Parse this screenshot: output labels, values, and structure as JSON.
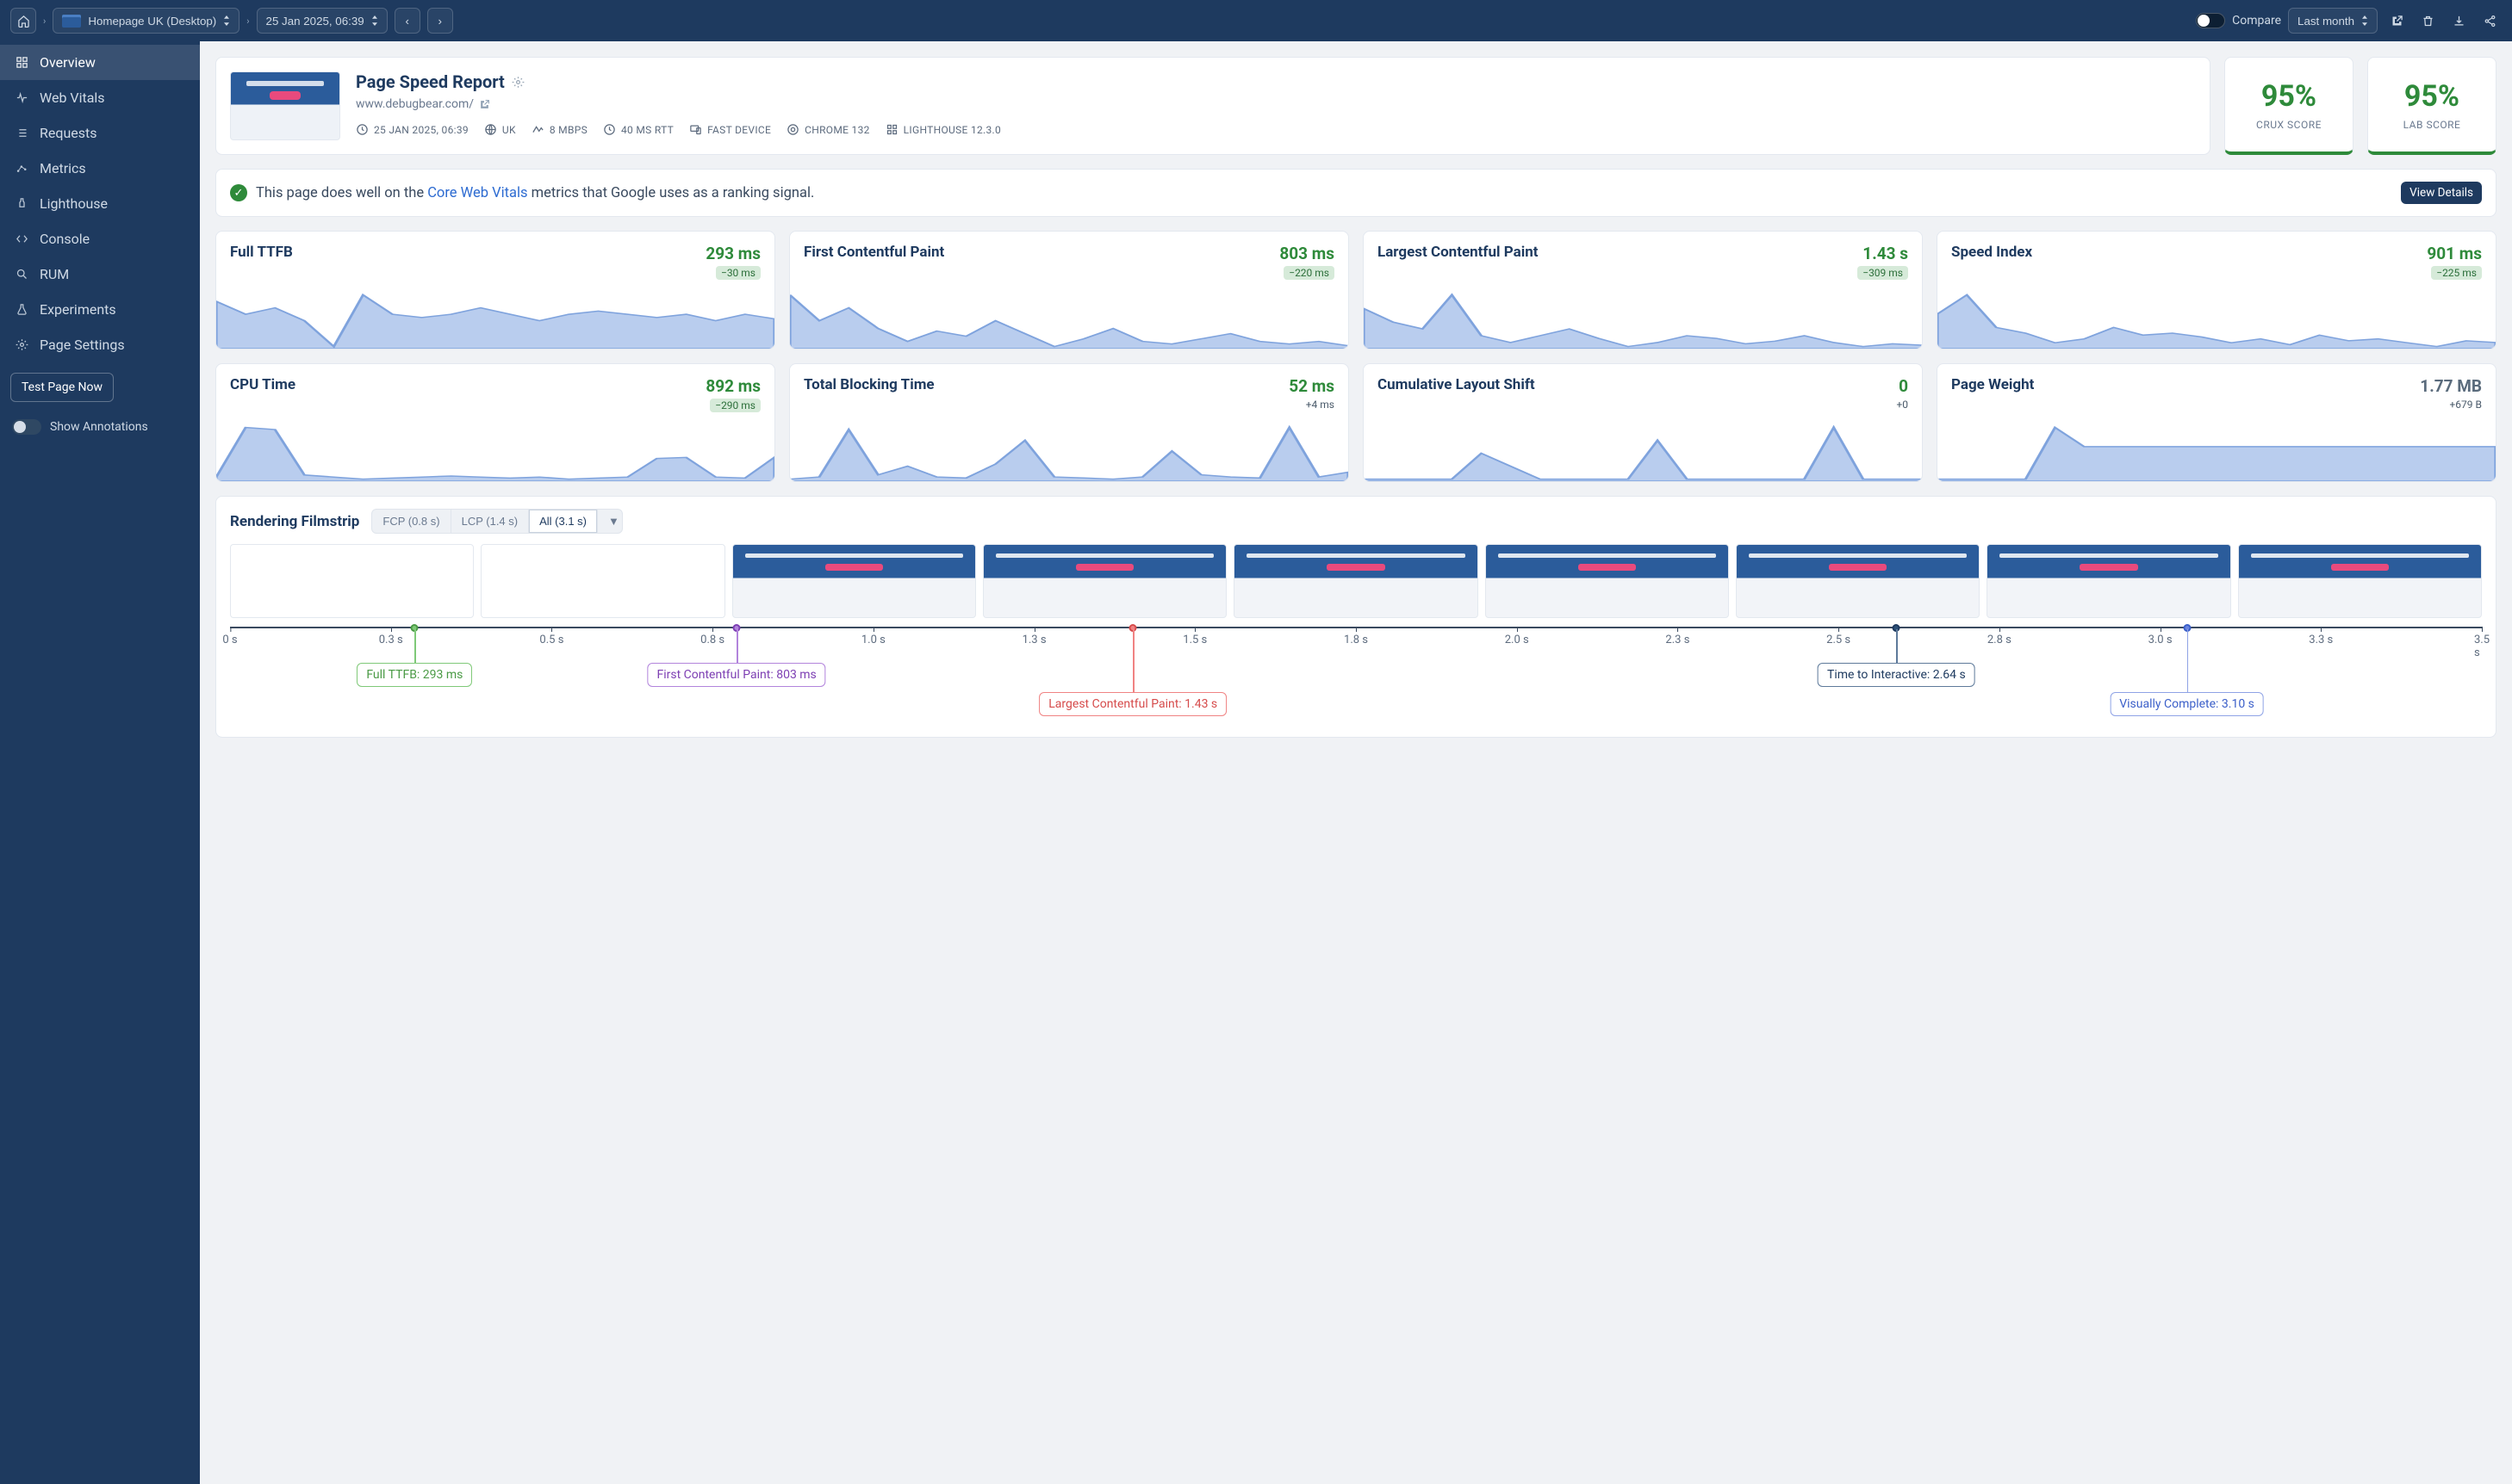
{
  "topbar": {
    "page_label": "Homepage UK (Desktop)",
    "date_label": "25 Jan 2025, 06:39",
    "compare_label": "Compare",
    "range_label": "Last month"
  },
  "sidebar": {
    "items": [
      {
        "icon": "grid",
        "label": "Overview",
        "active": true
      },
      {
        "icon": "pulse",
        "label": "Web Vitals"
      },
      {
        "icon": "list",
        "label": "Requests"
      },
      {
        "icon": "dots",
        "label": "Metrics"
      },
      {
        "icon": "light",
        "label": "Lighthouse"
      },
      {
        "icon": "code",
        "label": "Console"
      },
      {
        "icon": "search",
        "label": "RUM"
      },
      {
        "icon": "flask",
        "label": "Experiments"
      },
      {
        "icon": "gear",
        "label": "Page Settings"
      }
    ],
    "test_button": "Test Page Now",
    "annotations_label": "Show Annotations"
  },
  "report": {
    "title": "Page Speed Report",
    "url": "www.debugbear.com/",
    "meta": {
      "date": "25 JAN 2025, 06:39",
      "country": "UK",
      "bandwidth": "8 MBPS",
      "rtt": "40 MS RTT",
      "device": "FAST DEVICE",
      "browser": "CHROME 132",
      "lighthouse": "LIGHTHOUSE 12.3.0"
    }
  },
  "scores": {
    "crux": {
      "value": "95%",
      "label": "CRUX SCORE"
    },
    "lab": {
      "value": "95%",
      "label": "LAB SCORE"
    }
  },
  "cwv_banner": {
    "prefix": "This page does well on the ",
    "link": "Core Web Vitals",
    "suffix": " metrics that Google uses as a ranking signal.",
    "button": "View Details"
  },
  "metrics": [
    {
      "name": "Full TTFB",
      "value": "293 ms",
      "delta": "−30 ms",
      "color": "green",
      "badge": true
    },
    {
      "name": "First Contentful Paint",
      "value": "803 ms",
      "delta": "−220 ms",
      "color": "green",
      "badge": true
    },
    {
      "name": "Largest Contentful Paint",
      "value": "1.43 s",
      "delta": "−309 ms",
      "color": "green",
      "badge": true
    },
    {
      "name": "Speed Index",
      "value": "901 ms",
      "delta": "−225 ms",
      "color": "green",
      "badge": true
    },
    {
      "name": "CPU Time",
      "value": "892 ms",
      "delta": "−290 ms",
      "color": "green",
      "badge": true
    },
    {
      "name": "Total Blocking Time",
      "value": "52 ms",
      "delta": "+4 ms",
      "color": "green",
      "badge": false
    },
    {
      "name": "Cumulative Layout Shift",
      "value": "0",
      "delta": "+0",
      "color": "green",
      "badge": false
    },
    {
      "name": "Page Weight",
      "value": "1.77 MB",
      "delta": "+679 B",
      "color": "grey",
      "badge": false
    }
  ],
  "filmstrip": {
    "title": "Rendering Filmstrip",
    "tabs": {
      "fcp": "FCP (0.8 s)",
      "lcp": "LCP (1.4 s)",
      "all": "All (3.1 s)"
    },
    "axis_ticks": [
      "0 s",
      "0.3 s",
      "0.5 s",
      "0.8 s",
      "1.0 s",
      "1.3 s",
      "1.5 s",
      "1.8 s",
      "2.0 s",
      "2.3 s",
      "2.5 s",
      "2.8 s",
      "3.0 s",
      "3.3 s",
      "3.5 s"
    ],
    "markers": {
      "ttfb": {
        "label": "Full TTFB: 293 ms",
        "pct": 8.2
      },
      "fcp": {
        "label": "First Contentful Paint: 803 ms",
        "pct": 22.5
      },
      "lcp": {
        "label": "Largest Contentful Paint: 1.43 s",
        "pct": 40.1
      },
      "tti": {
        "label": "Time to Interactive: 2.64 s",
        "pct": 74.0
      },
      "vc": {
        "label": "Visually Complete: 3.10 s",
        "pct": 86.9
      }
    }
  },
  "chart_data": [
    {
      "type": "line",
      "title": "Full TTFB sparkline",
      "ylabel": "ms",
      "values": [
        320,
        300,
        310,
        290,
        250,
        330,
        300,
        295,
        300,
        310,
        300,
        290,
        300,
        305,
        300,
        295,
        300,
        290,
        300,
        293
      ]
    },
    {
      "type": "line",
      "title": "First Contentful Paint sparkline",
      "ylabel": "ms",
      "values": [
        1000,
        900,
        950,
        870,
        820,
        860,
        840,
        900,
        850,
        800,
        830,
        870,
        820,
        810,
        830,
        850,
        820,
        810,
        820,
        803
      ]
    },
    {
      "type": "line",
      "title": "Largest Contentful Paint sparkline",
      "ylabel": "s",
      "values": [
        1.7,
        1.6,
        1.55,
        1.8,
        1.5,
        1.45,
        1.5,
        1.55,
        1.48,
        1.42,
        1.45,
        1.5,
        1.48,
        1.44,
        1.46,
        1.5,
        1.45,
        1.42,
        1.44,
        1.43
      ]
    },
    {
      "type": "line",
      "title": "Speed Index sparkline",
      "ylabel": "ms",
      "values": [
        1050,
        1150,
        980,
        950,
        900,
        920,
        980,
        940,
        950,
        930,
        900,
        920,
        890,
        940,
        910,
        920,
        900,
        880,
        910,
        901
      ]
    },
    {
      "type": "line",
      "title": "CPU Time sparkline",
      "ylabel": "ms",
      "values": [
        700,
        1180,
        1160,
        720,
        700,
        680,
        690,
        700,
        710,
        700,
        690,
        700,
        680,
        690,
        700,
        880,
        890,
        700,
        690,
        892
      ]
    },
    {
      "type": "line",
      "title": "Total Blocking Time sparkline",
      "ylabel": "ms",
      "values": [
        20,
        30,
        250,
        40,
        80,
        30,
        25,
        90,
        200,
        30,
        25,
        20,
        30,
        150,
        40,
        30,
        25,
        260,
        30,
        52
      ]
    },
    {
      "type": "line",
      "title": "Cumulative Layout Shift sparkline",
      "ylabel": "",
      "values": [
        0,
        0,
        0,
        0,
        0.02,
        0.01,
        0,
        0,
        0,
        0,
        0.03,
        0,
        0,
        0,
        0,
        0,
        0.04,
        0,
        0,
        0
      ]
    },
    {
      "type": "line",
      "title": "Page Weight sparkline",
      "ylabel": "MB",
      "values": [
        1.55,
        1.55,
        1.55,
        1.55,
        1.9,
        1.77,
        1.77,
        1.77,
        1.77,
        1.77,
        1.77,
        1.77,
        1.77,
        1.77,
        1.77,
        1.77,
        1.77,
        1.77,
        1.77,
        1.77
      ]
    }
  ]
}
